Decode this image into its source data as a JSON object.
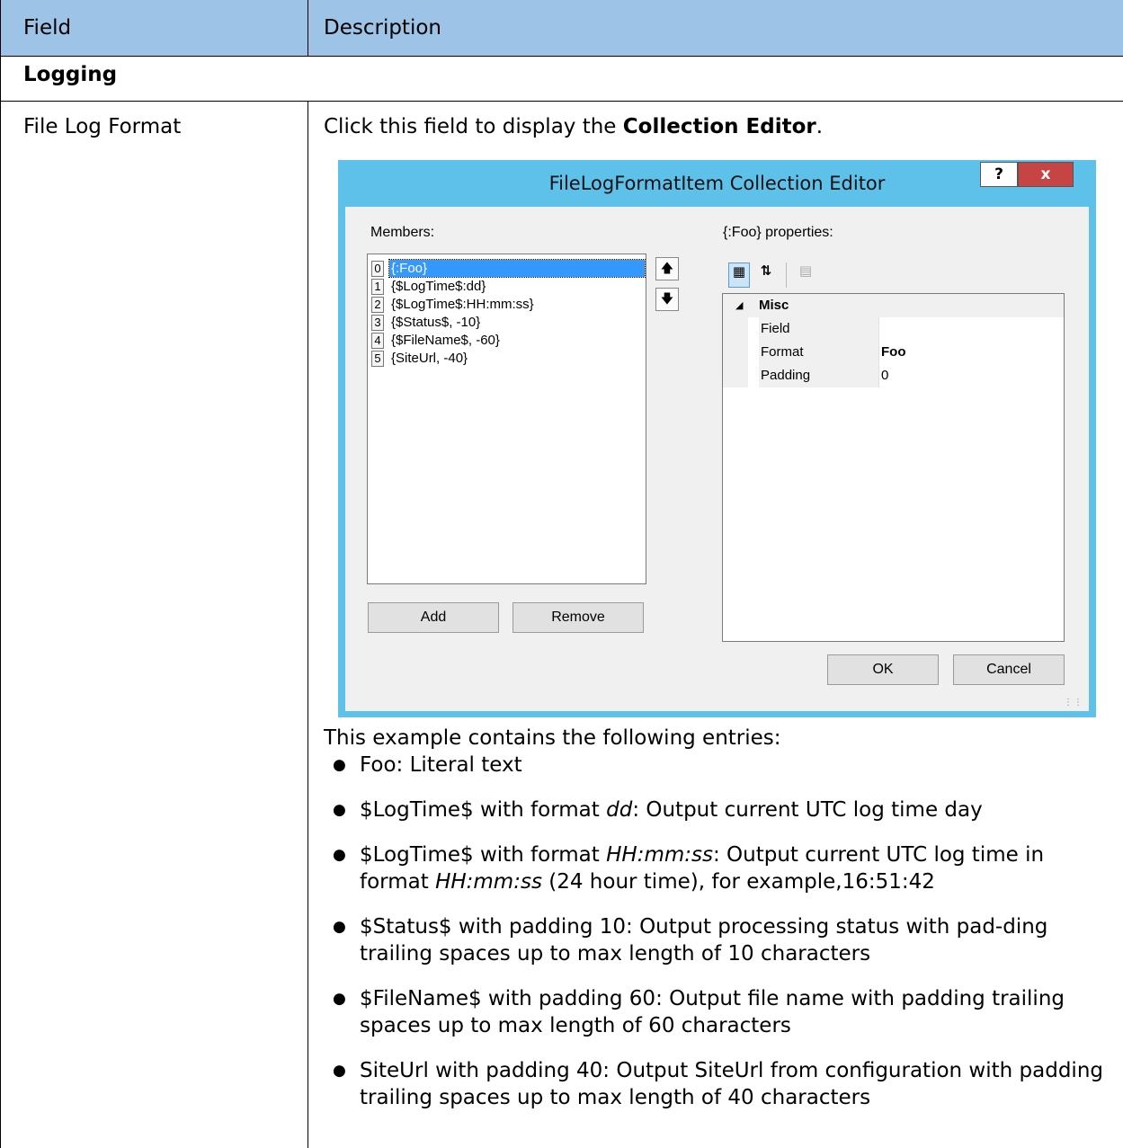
{
  "table": {
    "header_field": "Field",
    "header_description": "Description",
    "section": "Logging",
    "field_name": "File Log Format",
    "intro_prefix": "Click this field to display the ",
    "intro_bold": "Collection Editor",
    "intro_suffix": "."
  },
  "dialog": {
    "title": "FileLogFormatItem Collection Editor",
    "help_button": "?",
    "close_button": "x",
    "members_label": "Members:",
    "members": [
      {
        "index": "0",
        "text": "{:Foo}",
        "selected": true
      },
      {
        "index": "1",
        "text": "{$LogTime$:dd}",
        "selected": false
      },
      {
        "index": "2",
        "text": "{$LogTime$:HH:mm:ss}",
        "selected": false
      },
      {
        "index": "3",
        "text": "{$Status$, -10}",
        "selected": false
      },
      {
        "index": "4",
        "text": "{$FileName$, -60}",
        "selected": false
      },
      {
        "index": "5",
        "text": "{SiteUrl, -40}",
        "selected": false
      }
    ],
    "move_up_icon": "arrow-up-icon",
    "move_down_icon": "arrow-down-icon",
    "add_button": "Add",
    "remove_button": "Remove",
    "properties_label": "{:Foo}  properties:",
    "categorized_icon": "categorized-icon",
    "alphabetical_icon": "sort-az-icon",
    "property_pages_icon": "property-pages-icon",
    "category": "Misc",
    "properties": [
      {
        "name": "Field",
        "value": ""
      },
      {
        "name": "Format",
        "value": "Foo"
      },
      {
        "name": "Padding",
        "value": "0"
      }
    ],
    "ok_button": "OK",
    "cancel_button": "Cancel"
  },
  "description": {
    "intro": "This example contains the following entries:",
    "items": [
      {
        "p1": "Foo: Literal text",
        "i1": "",
        "p2": "",
        "i2": "",
        "p3": ""
      },
      {
        "p1": "$LogTime$  with format ",
        "i1": "dd",
        "p2": ": Output current UTC log time day",
        "i2": "",
        "p3": ""
      },
      {
        "p1": "$LogTime$ with format ",
        "i1": "HH:mm:ss",
        "p2": ": Output current UTC log time in format ",
        "i2": "HH:mm:ss",
        "p3": " (24 hour time), for example,16:51:42"
      },
      {
        "p1": "$Status$ with padding 10: Output processing status with pad-ding trailing spaces up to max length of 10 characters",
        "i1": "",
        "p2": "",
        "i2": "",
        "p3": ""
      },
      {
        "p1": "$FileName$ with padding 60: Output file name with padding trailing spaces up to max length of 60 characters",
        "i1": "",
        "p2": "",
        "i2": "",
        "p3": ""
      },
      {
        "p1": "SiteUrl with padding 40: Output SiteUrl from configuration with padding trailing spaces up to max length of 40 characters",
        "i1": "",
        "p2": "",
        "i2": "",
        "p3": ""
      }
    ]
  }
}
